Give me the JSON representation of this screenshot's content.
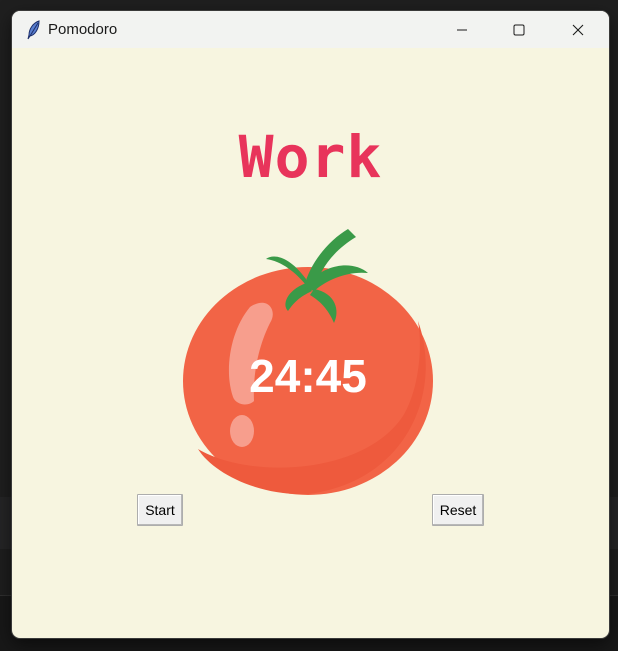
{
  "window": {
    "title": "Pomodoro",
    "icon": "feather-icon",
    "controls": [
      "minimize-icon",
      "maximize-icon",
      "close-icon"
    ]
  },
  "heading": {
    "label": "Work",
    "color": "#e8345b"
  },
  "timer": {
    "display": "24:45",
    "image": "tomato"
  },
  "buttons": {
    "start_label": "Start",
    "reset_label": "Reset"
  },
  "colors": {
    "background": "#f7f5e0",
    "tomato": "#f26446",
    "leaves": "#3a9a48"
  }
}
